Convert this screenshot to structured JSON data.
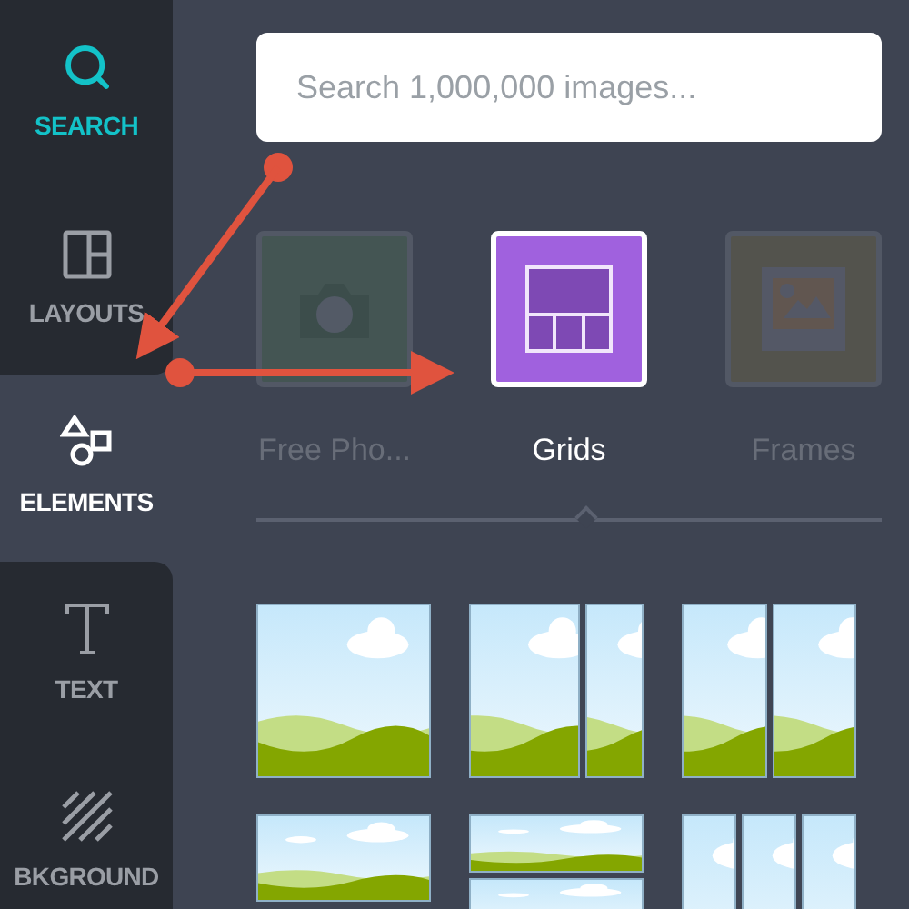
{
  "sidebar": {
    "items": [
      {
        "kind": "search",
        "label": "SEARCH",
        "active": true,
        "selected": false
      },
      {
        "kind": "layouts",
        "label": "LAYOUTS",
        "active": false,
        "selected": false
      },
      {
        "kind": "elements",
        "label": "ELEMENTS",
        "active": false,
        "selected": true
      },
      {
        "kind": "text",
        "label": "TEXT",
        "active": false,
        "selected": false
      },
      {
        "kind": "background",
        "label": "BKGROUND",
        "active": false,
        "selected": false
      }
    ]
  },
  "search": {
    "placeholder": "Search 1,000,000 images..."
  },
  "categories": [
    {
      "kind": "photos",
      "label": "Free Pho...",
      "selected": false
    },
    {
      "kind": "grids",
      "label": "Grids",
      "selected": true
    },
    {
      "kind": "frames",
      "label": "Frames",
      "selected": false
    }
  ],
  "grid_layouts": [
    {
      "kind": "single"
    },
    {
      "kind": "wide-narrow"
    },
    {
      "kind": "halves"
    },
    {
      "kind": "landscape"
    },
    {
      "kind": "stacked"
    },
    {
      "kind": "thirds"
    }
  ]
}
